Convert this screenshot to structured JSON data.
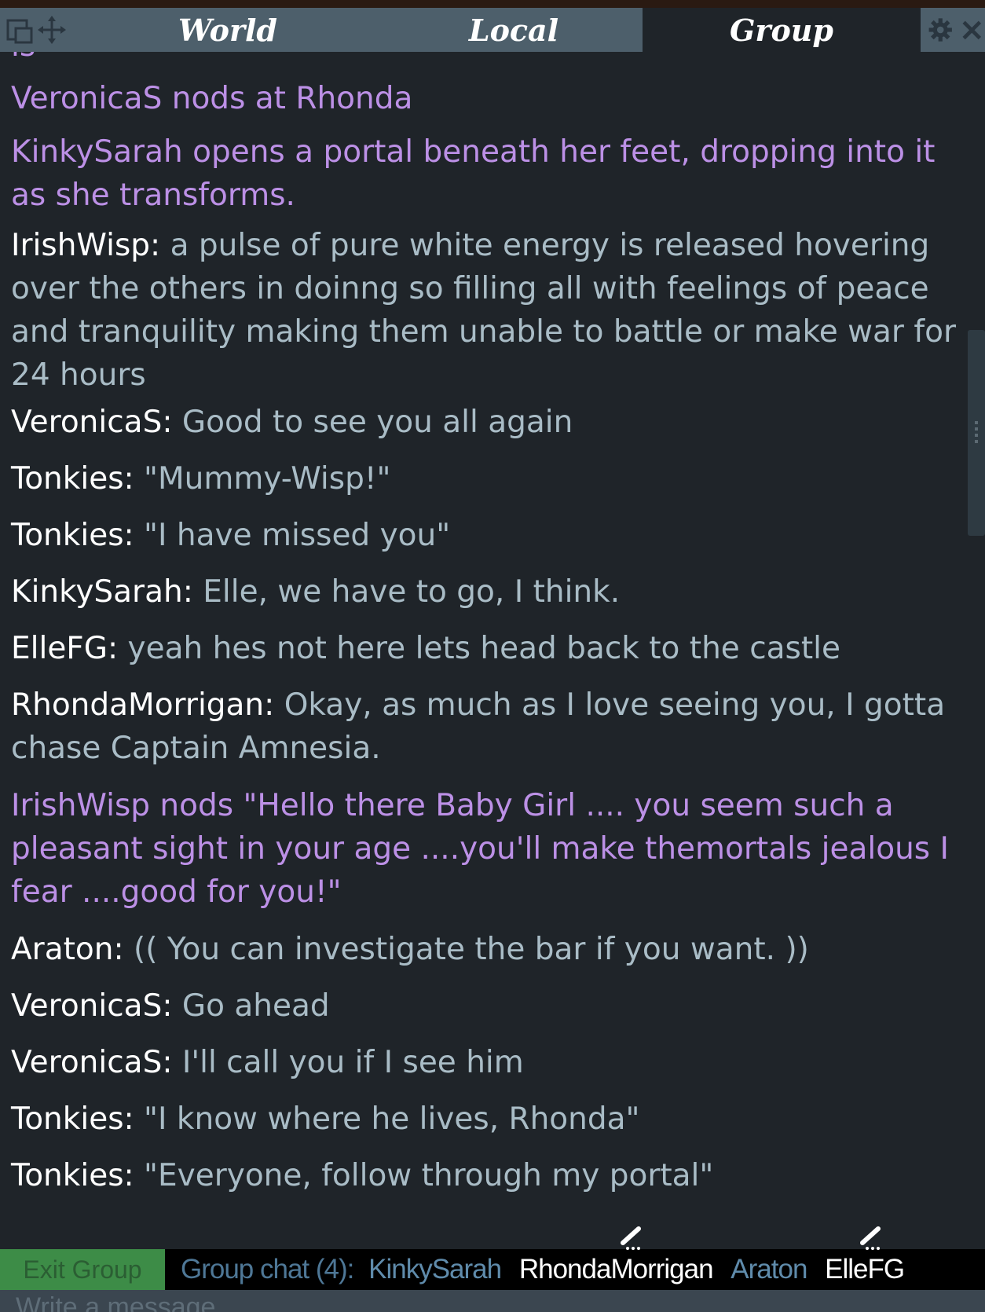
{
  "window": {
    "close_glyph": "×"
  },
  "tabs": [
    {
      "label": "World",
      "active": false
    },
    {
      "label": "Local",
      "active": false
    },
    {
      "label": "Group",
      "active": true
    }
  ],
  "colors": {
    "panel_bg": "#1f2429",
    "tab_bg": "#4d5f6b",
    "name_text": "#ffffff",
    "say_text": "#a9bcc6",
    "emote_text": "#bc90e6",
    "exit_button_bg": "#3d8c47"
  },
  "messages": [
    {
      "partial_text": "is",
      "type": "emote"
    },
    {
      "text": "VeronicaS nods at Rhonda",
      "type": "emote"
    },
    {
      "text": "KinkySarah opens a portal beneath her feet, dropping into it as she transforms.",
      "type": "emote"
    },
    {
      "name": "IrishWisp:",
      "text": " a pulse of pure white energy is released hovering over the others in doinng so filling all with feelings of peace and tranquility making them unable to battle or make war for 24 hours",
      "type": "say"
    },
    {
      "name": "VeronicaS:",
      "text": " Good to see you all again",
      "type": "say"
    },
    {
      "name": "Tonkies:",
      "text": " \"Mummy-Wisp!\"",
      "type": "say"
    },
    {
      "name": "Tonkies:",
      "text": " \"I have missed you\"",
      "type": "say"
    },
    {
      "name": "KinkySarah:",
      "text": " Elle, we have to go, I think.",
      "type": "say"
    },
    {
      "name": "ElleFG:",
      "text": " yeah hes not here lets head back to the castle",
      "type": "say"
    },
    {
      "name": "RhondaMorrigan:",
      "text": " Okay, as much as I love seeing you, I gotta chase Captain Amnesia.",
      "type": "say"
    },
    {
      "text": "IrishWisp nods \"Hello there Baby Girl .... you seem such a pleasant sight in your age ....you'll make themortals jealous I fear ....good for you!\"",
      "type": "emote"
    },
    {
      "name": "Araton:",
      "text": " (( You can investigate the bar if you want. ))",
      "type": "say"
    },
    {
      "name": "VeronicaS:",
      "text": " Go ahead",
      "type": "say"
    },
    {
      "name": "VeronicaS:",
      "text": " I'll call you if I see him",
      "type": "say"
    },
    {
      "name": "Tonkies:",
      "text": " \"I know where he lives, Rhonda\"",
      "type": "say"
    },
    {
      "name": "Tonkies:",
      "text": " \"Everyone, follow through my portal\"",
      "type": "say"
    }
  ],
  "footer": {
    "exit_button_label": "Exit Group",
    "group_label": "Group chat (4):",
    "members": [
      {
        "name": "KinkySarah",
        "typing": false
      },
      {
        "name": "RhondaMorrigan",
        "typing": true
      },
      {
        "name": "Araton",
        "typing": false
      },
      {
        "name": "ElleFG",
        "typing": true
      }
    ]
  },
  "input": {
    "placeholder": "Write a message..."
  }
}
